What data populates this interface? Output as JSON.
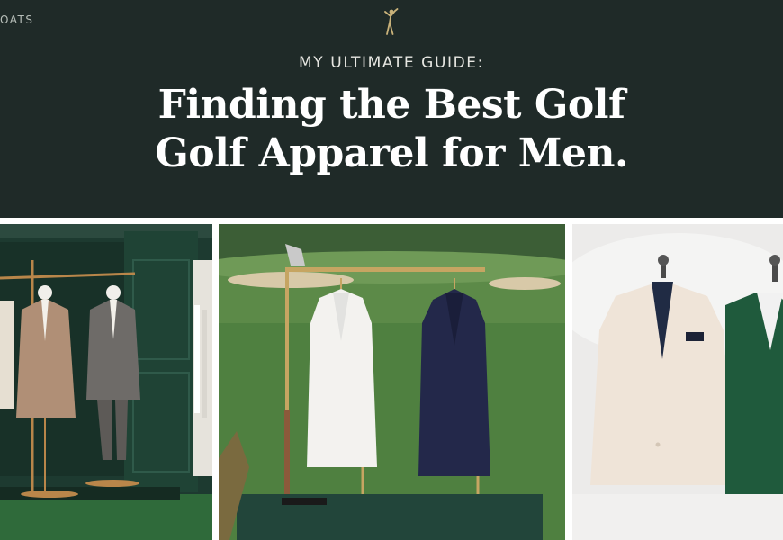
{
  "header": {
    "nav_fragment": "OATS",
    "kicker": "MY ULTIMATE GUIDE:",
    "title_line1": "Finding the Best Golf",
    "title_line2": "Golf Apparel for Men.",
    "logo_icon": "golfer-icon"
  },
  "colors": {
    "hero_bg": "#1f2a28",
    "accent_gold": "#c9b27a",
    "masters_green": "#1f4a3a"
  },
  "gallery": {
    "photos": [
      {
        "name": "boutique-display-photo"
      },
      {
        "name": "course-jacket-stand-photo"
      },
      {
        "name": "studio-blazers-photo"
      }
    ]
  }
}
